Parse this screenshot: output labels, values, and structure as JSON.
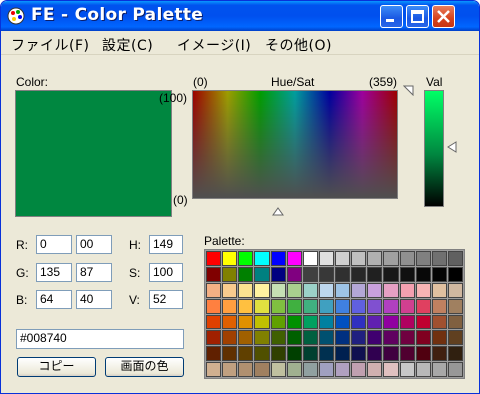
{
  "window": {
    "title": "FE - Color Palette"
  },
  "menu": [
    "ファイル(F)",
    "設定(C)",
    "イメージ(I)",
    "その他(O)"
  ],
  "color_label": "Color:",
  "current_color": "#008740",
  "huesat": {
    "label_left": "(0)",
    "label_center": "Hue/Sat",
    "label_right": "(359)",
    "label_top": "(100)",
    "label_bottom": "(0)"
  },
  "val_label": "Val",
  "rgb": {
    "r_label": "R:",
    "g_label": "G:",
    "b_label": "B:",
    "r_dec": "0",
    "r_hex": "00",
    "g_dec": "135",
    "g_hex": "87",
    "b_dec": "64",
    "b_hex": "40"
  },
  "hsv": {
    "h_label": "H:",
    "s_label": "S:",
    "v_label": "V:",
    "h": "149",
    "s": "100",
    "v": "52"
  },
  "hex_value": "#008740",
  "buttons": {
    "copy": "コピー",
    "screen_color": "画面の色"
  },
  "palette_label": "Palette:",
  "palette_rows": [
    [
      "#ff0000",
      "#ffff00",
      "#00ff00",
      "#00ffff",
      "#0000ff",
      "#ff00ff",
      "#ffffff",
      "#e0e0e0",
      "#d0d0d0",
      "#c0c0c0",
      "#b0b0b0",
      "#a0a0a0",
      "#909090",
      "#808080",
      "#707070",
      "#606060"
    ],
    [
      "#800000",
      "#808000",
      "#008000",
      "#008080",
      "#000080",
      "#800080",
      "#404040",
      "#383838",
      "#303030",
      "#282828",
      "#202020",
      "#181818",
      "#101010",
      "#080808",
      "#040404",
      "#000000"
    ],
    [
      "#f4b084",
      "#f8cb8e",
      "#fae290",
      "#fff2a0",
      "#c6e0b4",
      "#a9d08e",
      "#9bd1c8",
      "#bdd7ee",
      "#9dc3e6",
      "#b4a7d6",
      "#c9a0dc",
      "#e6a0c4",
      "#f4a0b0",
      "#f8b4b4",
      "#e0c0a0",
      "#d0b8a0"
    ],
    [
      "#ff8040",
      "#ff9f40",
      "#ffc040",
      "#e0e040",
      "#80c040",
      "#40b040",
      "#40b080",
      "#40a0c0",
      "#4080e0",
      "#6060e0",
      "#8050d0",
      "#b040c0",
      "#d04090",
      "#e04060",
      "#c08060",
      "#a08060"
    ],
    [
      "#e04000",
      "#e06000",
      "#e09000",
      "#c0c000",
      "#60a000",
      "#009000",
      "#00a060",
      "#0080a0",
      "#0050c0",
      "#3030c0",
      "#6020b0",
      "#9000a0",
      "#b00060",
      "#c00030",
      "#a05030",
      "#806040"
    ],
    [
      "#a02000",
      "#a04000",
      "#a06000",
      "#808000",
      "#406000",
      "#006000",
      "#006040",
      "#005070",
      "#003080",
      "#202080",
      "#400070",
      "#600060",
      "#700040",
      "#800020",
      "#703010",
      "#604020"
    ],
    [
      "#602000",
      "#603000",
      "#604000",
      "#505000",
      "#304000",
      "#004000",
      "#004030",
      "#003050",
      "#002050",
      "#101050",
      "#300050",
      "#400040",
      "#500030",
      "#500010",
      "#402010",
      "#302010"
    ],
    [
      "#d0b090",
      "#c0a080",
      "#b09070",
      "#a08060",
      "#c0c0a0",
      "#a0b090",
      "#90a0a0",
      "#a0a0c0",
      "#b0a0c0",
      "#c0a0b0",
      "#d0b0b0",
      "#e0c0c0",
      "#c8c8c8",
      "#b8b8b8",
      "#a8a8a8",
      "#989898"
    ]
  ]
}
